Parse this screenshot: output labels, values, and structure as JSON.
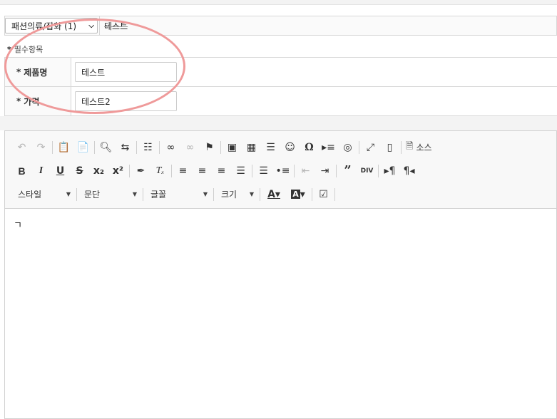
{
  "category": {
    "select_value": "패션의류/잡화 (1)",
    "value_text": "테스트"
  },
  "required_note": "필수항목",
  "form": {
    "rows": [
      {
        "label": "제품명",
        "value": "테스트"
      },
      {
        "label": "가격",
        "value": "테스트2"
      }
    ]
  },
  "editor": {
    "source_label": "소스",
    "combos": {
      "style": "스타일",
      "paragraph": "문단",
      "font": "글꼴",
      "size": "크기"
    },
    "content": "ㄱ"
  },
  "colors": {
    "annotation_circle": "#ef9a9a",
    "border": "#d8d8d8",
    "toolbar_bg": "#f8f8f8"
  }
}
